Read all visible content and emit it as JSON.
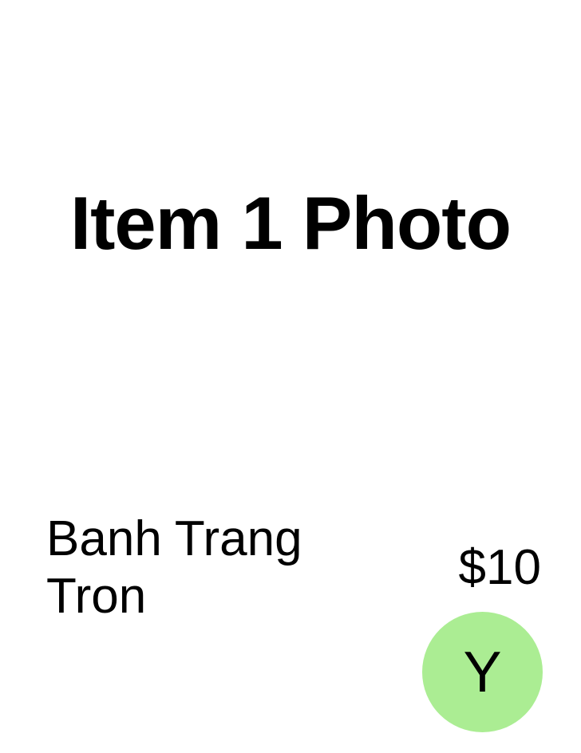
{
  "item": {
    "photo_label": "Item 1 Photo",
    "name": "Banh Trang Tron",
    "price": "$10"
  },
  "select_button": {
    "label": "Y",
    "color": "#abed93"
  }
}
